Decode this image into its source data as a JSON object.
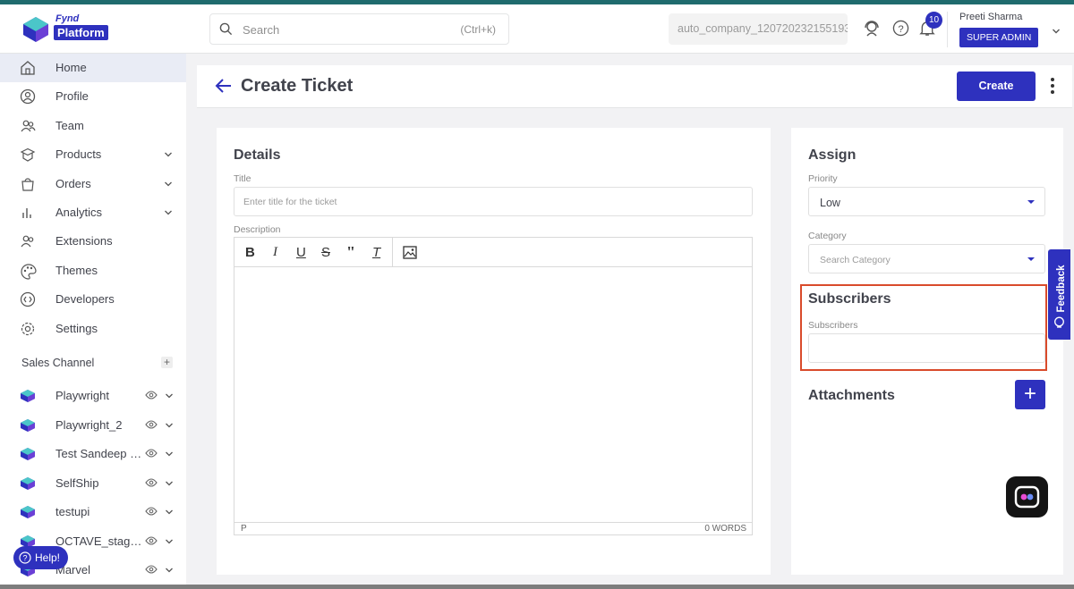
{
  "brand": {
    "logo_top": "Fynd",
    "logo_bottom": "Platform",
    "primary_color": "#2e31be"
  },
  "header": {
    "search_placeholder": "Search",
    "search_shortcut": "(Ctrl+k)",
    "company_id": "auto_company_120720232155193",
    "notification_count": "10",
    "user_name": "Preeti Sharma",
    "user_role": "SUPER ADMIN"
  },
  "sidebar": {
    "items": [
      {
        "label": "Home",
        "icon": "home-icon"
      },
      {
        "label": "Profile",
        "icon": "profile-icon"
      },
      {
        "label": "Team",
        "icon": "team-icon"
      },
      {
        "label": "Products",
        "icon": "products-icon"
      },
      {
        "label": "Orders",
        "icon": "orders-icon"
      },
      {
        "label": "Analytics",
        "icon": "analytics-icon"
      },
      {
        "label": "Extensions",
        "icon": "extensions-icon"
      },
      {
        "label": "Themes",
        "icon": "themes-icon"
      },
      {
        "label": "Developers",
        "icon": "developers-icon"
      },
      {
        "label": "Settings",
        "icon": "settings-icon"
      }
    ],
    "sales_channel_title": "Sales Channel",
    "channels": [
      "Playwright",
      "Playwright_2",
      "Test Sandeep C...",
      "SelfShip",
      "testupi",
      "OCTAVE_staging",
      "Marvel"
    ],
    "help_label": "Help!"
  },
  "page": {
    "title": "Create Ticket",
    "create_label": "Create"
  },
  "details": {
    "heading": "Details",
    "title_label": "Title",
    "title_placeholder": "Enter title for the ticket",
    "description_label": "Description",
    "status_block": "P",
    "word_count": "0 WORDS"
  },
  "assign": {
    "heading": "Assign",
    "priority_label": "Priority",
    "priority_value": "Low",
    "category_label": "Category",
    "category_placeholder": "Search Category",
    "subscribers_heading": "Subscribers",
    "subscribers_label": "Subscribers",
    "attachments_heading": "Attachments"
  },
  "feedback_label": "Feedback"
}
